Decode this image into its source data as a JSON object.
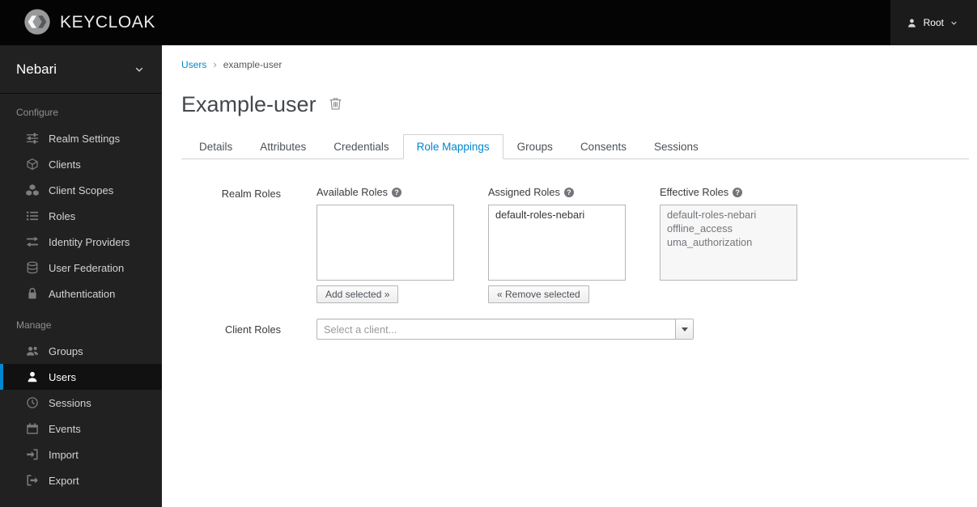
{
  "topbar": {
    "brand": "KEYCLOAK",
    "user_label": "Root"
  },
  "sidebar": {
    "realm_name": "Nebari",
    "sections": [
      {
        "title": "Configure",
        "items": [
          {
            "label": "Realm Settings",
            "icon": "sliders-icon",
            "active": false
          },
          {
            "label": "Clients",
            "icon": "cube-icon",
            "active": false
          },
          {
            "label": "Client Scopes",
            "icon": "cubes-icon",
            "active": false
          },
          {
            "label": "Roles",
            "icon": "list-icon",
            "active": false
          },
          {
            "label": "Identity Providers",
            "icon": "exchange-arrows-icon",
            "active": false
          },
          {
            "label": "User Federation",
            "icon": "database-icon",
            "active": false
          },
          {
            "label": "Authentication",
            "icon": "lock-icon",
            "active": false
          }
        ]
      },
      {
        "title": "Manage",
        "items": [
          {
            "label": "Groups",
            "icon": "group-icon",
            "active": false
          },
          {
            "label": "Users",
            "icon": "user-icon",
            "active": true
          },
          {
            "label": "Sessions",
            "icon": "clock-icon",
            "active": false
          },
          {
            "label": "Events",
            "icon": "calendar-icon",
            "active": false
          },
          {
            "label": "Import",
            "icon": "import-icon",
            "active": false
          },
          {
            "label": "Export",
            "icon": "export-icon",
            "active": false
          }
        ]
      }
    ]
  },
  "breadcrumb": {
    "parent": "Users",
    "current": "example-user"
  },
  "page_title": "Example-user",
  "tabs": [
    {
      "label": "Details",
      "active": false
    },
    {
      "label": "Attributes",
      "active": false
    },
    {
      "label": "Credentials",
      "active": false
    },
    {
      "label": "Role Mappings",
      "active": true
    },
    {
      "label": "Groups",
      "active": false
    },
    {
      "label": "Consents",
      "active": false
    },
    {
      "label": "Sessions",
      "active": false
    }
  ],
  "role_mappings": {
    "realm_roles_label": "Realm Roles",
    "available": {
      "header": "Available Roles",
      "items": [],
      "action": "Add selected »"
    },
    "assigned": {
      "header": "Assigned Roles",
      "items": [
        "default-roles-nebari"
      ],
      "action": "« Remove selected"
    },
    "effective": {
      "header": "Effective Roles",
      "items": [
        "default-roles-nebari",
        "offline_access",
        "uma_authorization"
      ]
    },
    "client_roles_label": "Client Roles",
    "client_select_placeholder": "Select a client..."
  },
  "colors": {
    "link_blue": "#0088ce",
    "active_nav_border": "#0088ce",
    "topbar_bg": "#040404",
    "sidebar_bg": "#212121"
  }
}
